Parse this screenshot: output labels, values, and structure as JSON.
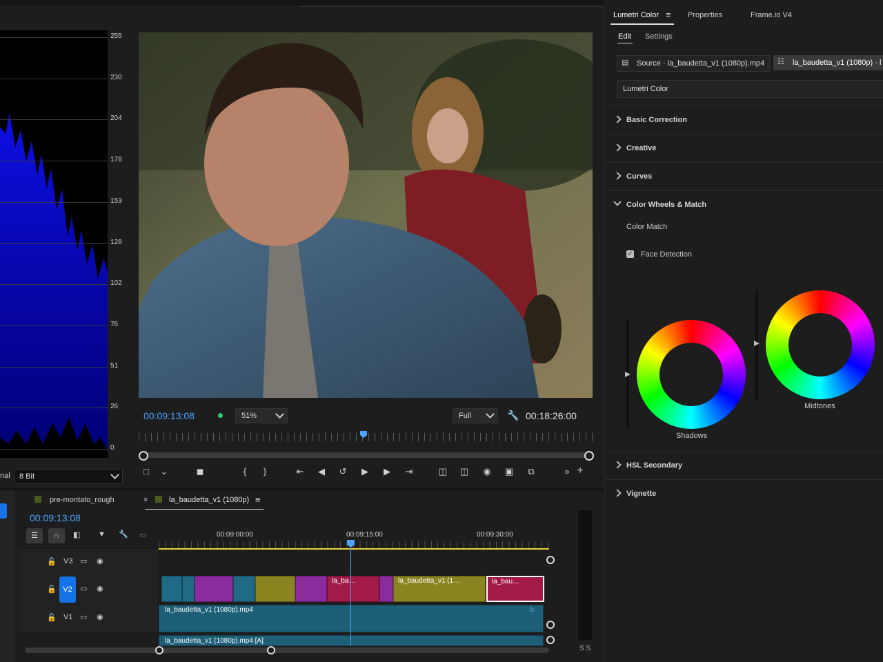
{
  "scope": {
    "ticks": [
      "255",
      "230",
      "204",
      "178",
      "153",
      "128",
      "102",
      "76",
      "51",
      "26",
      "0"
    ],
    "left_label": "nal",
    "bit_depth": "8 Bit"
  },
  "monitor": {
    "timecode": "00:09:13:08",
    "zoom": "51%",
    "quality": "Full",
    "duration": "00:18:26:00"
  },
  "timeline": {
    "tab_1": "pre-montato_rough",
    "tab_2": "la_baudetta_v1 (1080p)",
    "timecode": "00:09:13:08",
    "ruler": [
      "00:09:00:00",
      "00:09:15:00",
      "00:09:30:00"
    ],
    "tracks": {
      "v3": "V3",
      "v2": "V2",
      "v1": "V1"
    },
    "clips": {
      "v2_a": "la_ba…",
      "v2_b": "la_baudetta_v1 (1…",
      "v2_c": "la_bau…",
      "v1": "la_baudetta_v1 (1080p).mp4",
      "a1": "la_baudetta_v1 (1080p).mp4 [A]",
      "fx": "fx"
    },
    "meter_label": "S S"
  },
  "lumetri": {
    "tabs": [
      "Lumetri Color",
      "Properties",
      "Frame.io V4"
    ],
    "subtabs": [
      "Edit",
      "Settings"
    ],
    "source": "Source · la_baudetta_v1 (1080p).mp4",
    "sequence_clip": "la_baudetta_v1 (1080p) · l",
    "effect_name": "Lumetri Color",
    "sections": {
      "basic": "Basic Correction",
      "creative": "Creative",
      "curves": "Curves",
      "wheels": "Color Wheels & Match",
      "hsl": "HSL Secondary",
      "vignette": "Vignette"
    },
    "color_match": "Color Match",
    "face_detection": "Face Detection",
    "face_detection_checked": true,
    "wheels": {
      "shadows": "Shadows",
      "midtones": "Midtones"
    }
  }
}
